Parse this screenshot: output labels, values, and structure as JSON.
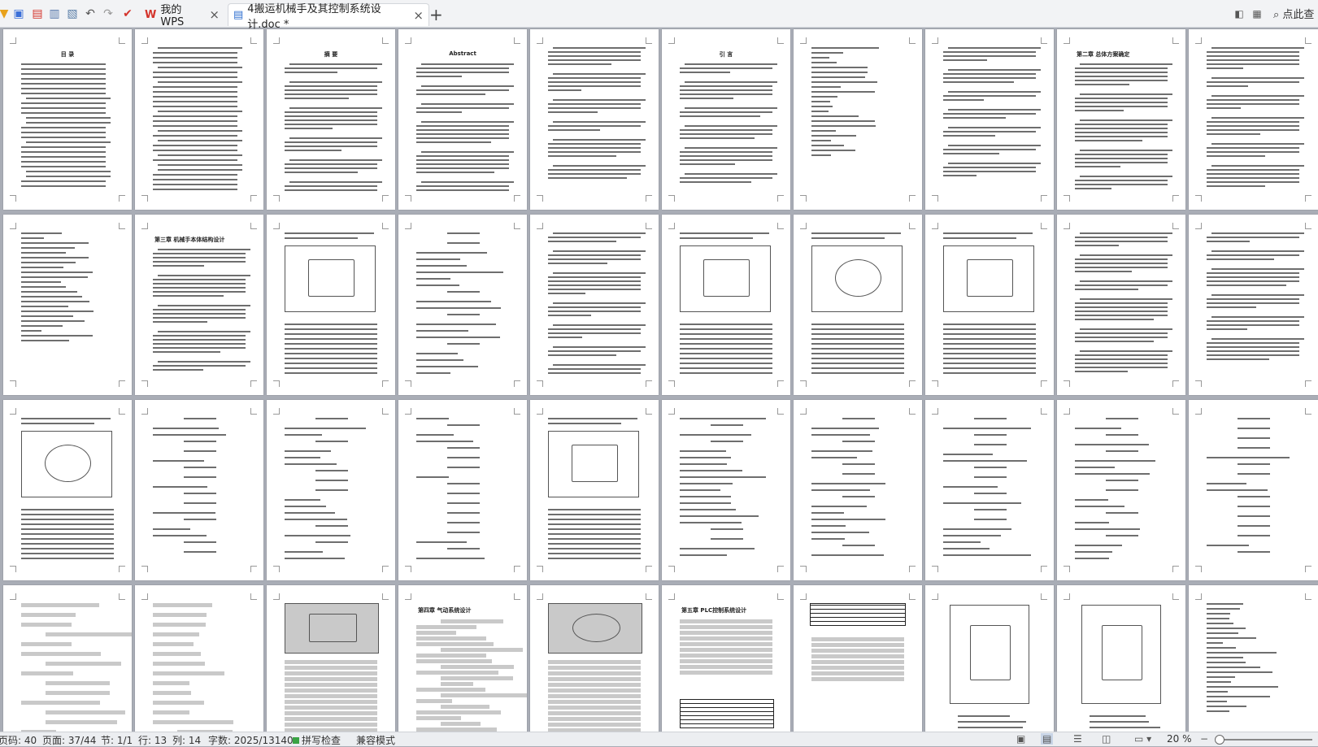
{
  "toolbar": {
    "icons": [
      "wps-menu-icon",
      "save-icon",
      "export-pdf-icon",
      "print-icon",
      "print-preview-icon",
      "undo-icon",
      "redo-icon",
      "customize-icon"
    ]
  },
  "tabs": [
    {
      "label": "我的WPS",
      "close": "×",
      "logo": "W"
    },
    {
      "label": "4搬运机械手及其控制系统设计.doc *",
      "close": "×"
    }
  ],
  "new_tab": "+",
  "right_toolbar": {
    "search_label": "点此查"
  },
  "colors": {
    "wps_red": "#d4342c",
    "accent_blue": "#2f6fd0",
    "status_green": "#3aa344"
  },
  "page_titles": {
    "r0": [
      "目 录",
      "",
      "摘 要",
      "Abstract",
      "",
      "引 言",
      "",
      "",
      "第二章 总体方案确定",
      ""
    ],
    "r1": [
      "",
      "第三章 机械手本体结构设计",
      "",
      "",
      "",
      "",
      "",
      "",
      "",
      ""
    ],
    "r3": [
      "",
      "",
      "",
      "第四章 气动系统设计",
      "",
      "第五章 PLC控制系统设计",
      "",
      "",
      "",
      ""
    ]
  },
  "statusbar": {
    "page_code": "页码: 40",
    "page": "页面: 37/44",
    "section": "节: 1/1",
    "row": "行: 13",
    "column": "列: 14",
    "word_count": "字数: 2025/13140",
    "spell_check": "拼写检查",
    "compat_mode": "兼容模式",
    "zoom": "20 %"
  }
}
